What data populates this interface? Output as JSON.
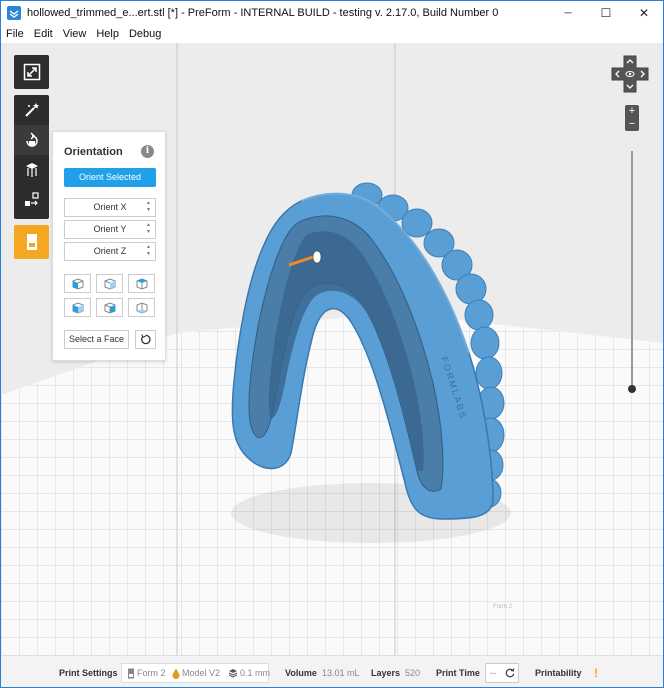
{
  "window": {
    "title": "hollowed_trimmed_e...ert.stl [*] - PreForm - INTERNAL BUILD - testing v. 2.17.0, Build Number 0",
    "controls": {
      "minimize": "─",
      "maximize": "☐",
      "close": "✕"
    }
  },
  "menu": [
    "File",
    "Edit",
    "View",
    "Help",
    "Debug"
  ],
  "toolbar": {
    "top": {
      "icon": "fit-to-view-icon"
    },
    "tools": [
      {
        "icon": "magic-wand-icon"
      },
      {
        "icon": "orientation-icon",
        "active": true
      },
      {
        "icon": "supports-icon"
      },
      {
        "icon": "layout-icon"
      }
    ],
    "bottom": {
      "icon": "print-icon"
    }
  },
  "orientation_panel": {
    "title": "Orientation",
    "info": "i",
    "orient_button": "Orient Selected",
    "orient_x": "Orient X",
    "orient_y": "Orient Y",
    "orient_z": "Orient Z",
    "select_face": "Select a Face"
  },
  "model": {
    "engraving": "FORMLABS",
    "color": "#5a9ed6"
  },
  "build_platform": {
    "label": "Form 2"
  },
  "status_bar": {
    "print_settings_label": "Print Settings",
    "printer": "Form 2",
    "material": "Model V2",
    "layer_height": "0.1 mm",
    "volume_label": "Volume",
    "volume_value": "13.01 mL",
    "layers_label": "Layers",
    "layers_value": "520",
    "print_time_label": "Print Time",
    "print_time_value": "--",
    "printability_label": "Printability",
    "printability_value": "!"
  },
  "colors": {
    "accent": "#1fa0e8",
    "toolbar": "#2d2d2d",
    "print_button": "#f5a623",
    "warning": "#f5a623"
  }
}
